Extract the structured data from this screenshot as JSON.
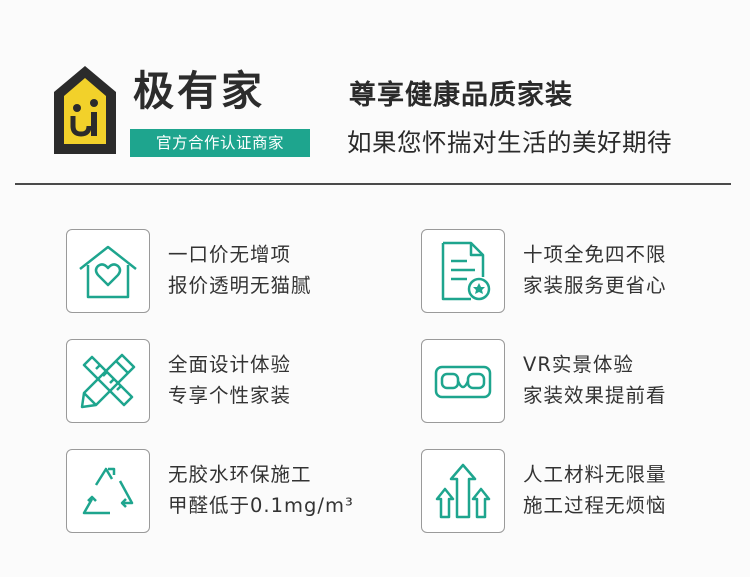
{
  "brand": {
    "logo_icon": "house-ui-logo-icon",
    "name": "极有家",
    "badge": "官方合作认证商家",
    "accent_color": "#1ea58e",
    "logo_yellow": "#f2d12a"
  },
  "slogan": {
    "line1": "尊享健康品质家装",
    "line2": "如果您怀揣对生活的美好期待"
  },
  "features": [
    {
      "icon": "heart-house-icon",
      "line1": "一口价无增项",
      "line2": "报价透明无猫腻"
    },
    {
      "icon": "document-star-icon",
      "line1": "十项全免四不限",
      "line2": "家装服务更省心"
    },
    {
      "icon": "pencil-ruler-icon",
      "line1": "全面设计体验",
      "line2": "专享个性家装"
    },
    {
      "icon": "vr-goggles-icon",
      "line1": "VR实景体验",
      "line2": "家装效果提前看"
    },
    {
      "icon": "recycle-icon",
      "line1": "无胶水环保施工",
      "line2": "甲醛低于0.1mg/m³"
    },
    {
      "icon": "arrows-up-icon",
      "line1": "人工材料无限量",
      "line2": "施工过程无烦恼"
    }
  ]
}
